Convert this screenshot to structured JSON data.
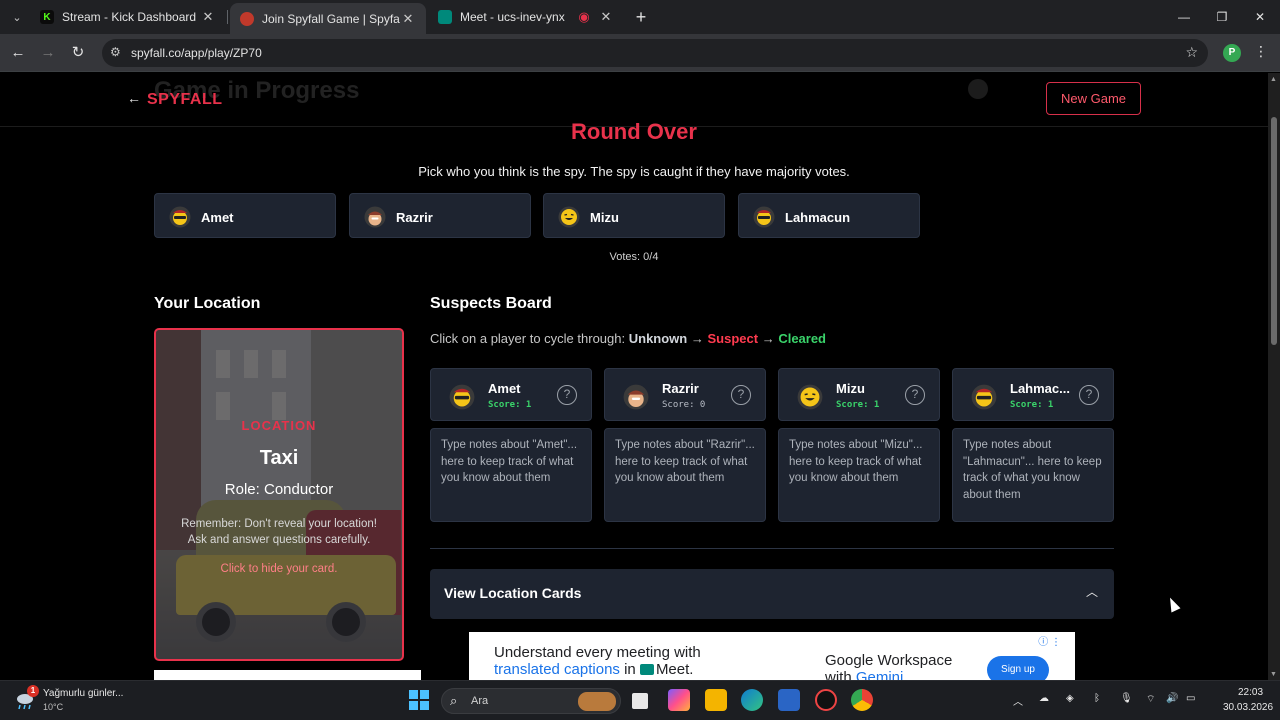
{
  "browser": {
    "tabs": [
      {
        "title": "Stream - Kick Dashboard",
        "favicon": "K",
        "favicon_color": "#53fc18",
        "active": false
      },
      {
        "title": "Join Spyfall Game | Spyfall Online",
        "favicon": "",
        "favicon_color": "#c0392b",
        "active": true
      },
      {
        "title": "Meet - ucs-inev-ynx",
        "favicon": "",
        "favicon_color": "#00897b",
        "active": false
      }
    ],
    "url": "spyfall.co/app/play/ZP70",
    "profile_initial": "P",
    "icons": {
      "menu": "chevron-down-icon",
      "close": "close-icon",
      "new_tab": "plus-icon",
      "back": "arrow-left-icon",
      "forward": "arrow-right-icon",
      "reload": "reload-icon",
      "site_info": "tune-icon",
      "bookmark": "star-icon",
      "more": "kebab-icon"
    }
  },
  "header": {
    "brand": "SPYFALL",
    "ghost_title": "Game in Progress",
    "new_game_label": "New Game",
    "accent": "#e8324b"
  },
  "round": {
    "title": "Round Over",
    "hint": "Pick who you think is the spy. The spy is caught if they have majority votes.",
    "votes_text": "Votes: 0/4",
    "players": [
      {
        "name": "Amet",
        "avatar": "sunglasses-face-icon"
      },
      {
        "name": "Razrir",
        "avatar": "cowboy-face-icon"
      },
      {
        "name": "Mizu",
        "avatar": "grin-face-icon"
      },
      {
        "name": "Lahmacun",
        "avatar": "sunglasses-face-icon"
      }
    ]
  },
  "location": {
    "heading": "Your Location",
    "label": "LOCATION",
    "name": "Taxi",
    "role": "Role: Conductor",
    "reminder_line1": "Remember: Don't reveal your location!",
    "reminder_line2": "Ask and answer questions carefully.",
    "hide_hint": "Click to hide your card."
  },
  "suspects": {
    "heading": "Suspects Board",
    "hint_prefix": "Click on a player to cycle through:",
    "status_unknown": "Unknown",
    "status_suspect": "Suspect",
    "status_cleared": "Cleared",
    "arrow": "→",
    "status_colors": {
      "unknown": "#d2d6dc",
      "suspect": "#ff3b4f",
      "cleared": "#3ad36a"
    },
    "cards": [
      {
        "name": "Amet",
        "score": "Score: 1",
        "notes_placeholder": "Type notes about \"Amet\"... here to keep track of what you know about them"
      },
      {
        "name": "Razrir",
        "score": "Score: 0",
        "notes_placeholder": "Type notes about \"Razrir\"... here to keep track of what you know about them"
      },
      {
        "name": "Mizu",
        "score": "Score: 1",
        "notes_placeholder": "Type notes about \"Mizu\"... here to keep track of what you know about them"
      },
      {
        "name": "Lahmac...",
        "score": "Score: 1",
        "notes_placeholder": "Type notes about \"Lahmacun\"... here to keep track of what you know about them"
      }
    ],
    "status_icon": "question-circle-icon"
  },
  "view_locations": {
    "label": "View Location Cards",
    "icon": "chevron-up-icon"
  },
  "ad": {
    "line1": "Understand every meeting with",
    "line2_blue": "translated captions",
    "line2_rest": " in ",
    "line2_meet": "Meet.",
    "brand_line1": "Google Workspace",
    "brand_line2_prefix": "with ",
    "brand_line2_blue": "Gemini",
    "signup": "Sign up"
  },
  "taskbar": {
    "weather_text": "Yağmurlu günler...",
    "temperature": "10°C",
    "weather_badge": "1",
    "search_placeholder": "Ara",
    "time": "22:03",
    "date": "30.03.2026"
  }
}
